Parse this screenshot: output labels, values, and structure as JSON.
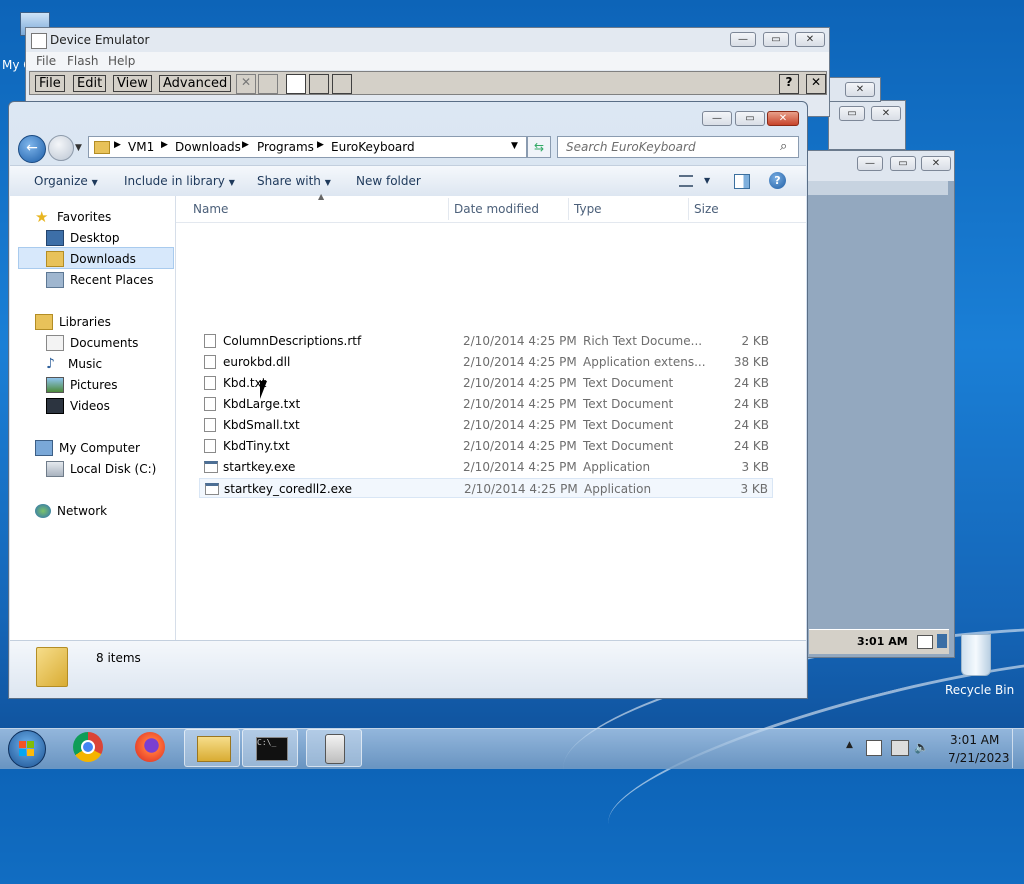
{
  "desktop": {
    "mycomputer_label": "My C",
    "recycle_label": "Recycle Bin"
  },
  "emulator": {
    "title": "Device Emulator",
    "menu": [
      "File",
      "Flash",
      "Help"
    ],
    "device_menu": [
      "File",
      "Edit",
      "View",
      "Advanced"
    ],
    "help_btn": "?",
    "close_btn": "✕",
    "clock": "3:01 AM"
  },
  "explorer": {
    "breadcrumb": [
      "VM1",
      "Downloads",
      "Programs",
      "EuroKeyboard"
    ],
    "search_placeholder": "Search EuroKeyboard",
    "toolbar": {
      "organize": "Organize",
      "include": "Include in library",
      "share": "Share with",
      "newfolder": "New folder"
    },
    "nav": {
      "favorites": "Favorites",
      "desktop": "Desktop",
      "downloads": "Downloads",
      "recent": "Recent Places",
      "libraries": "Libraries",
      "documents": "Documents",
      "music": "Music",
      "pictures": "Pictures",
      "videos": "Videos",
      "mycomputer": "My Computer",
      "localdisk": "Local Disk (C:)",
      "network": "Network"
    },
    "columns": {
      "name": "Name",
      "date": "Date modified",
      "type": "Type",
      "size": "Size"
    },
    "files": [
      {
        "name": "ColumnDescriptions.rtf",
        "date": "2/10/2014 4:25 PM",
        "type": "Rich Text Docume...",
        "size": "2 KB"
      },
      {
        "name": "eurokbd.dll",
        "date": "2/10/2014 4:25 PM",
        "type": "Application extens...",
        "size": "38 KB"
      },
      {
        "name": "Kbd.txt",
        "date": "2/10/2014 4:25 PM",
        "type": "Text Document",
        "size": "24 KB"
      },
      {
        "name": "KbdLarge.txt",
        "date": "2/10/2014 4:25 PM",
        "type": "Text Document",
        "size": "24 KB"
      },
      {
        "name": "KbdSmall.txt",
        "date": "2/10/2014 4:25 PM",
        "type": "Text Document",
        "size": "24 KB"
      },
      {
        "name": "KbdTiny.txt",
        "date": "2/10/2014 4:25 PM",
        "type": "Text Document",
        "size": "24 KB"
      },
      {
        "name": "startkey.exe",
        "date": "2/10/2014 4:25 PM",
        "type": "Application",
        "size": "3 KB"
      },
      {
        "name": "startkey_coredll2.exe",
        "date": "2/10/2014 4:25 PM",
        "type": "Application",
        "size": "3 KB"
      }
    ],
    "status": "8 items"
  },
  "taskbar": {
    "time": "3:01 AM",
    "date": "7/21/2023"
  }
}
